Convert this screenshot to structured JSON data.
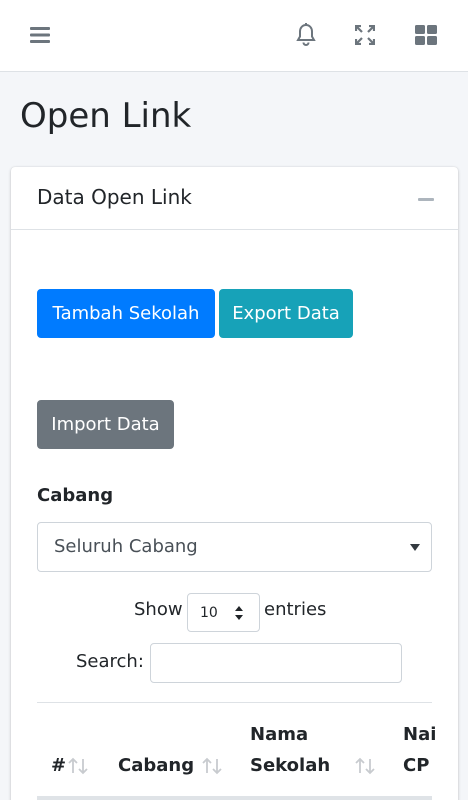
{
  "topbar": {
    "icons": [
      "hamburger-menu-icon",
      "bell-icon",
      "fullscreen-icon",
      "apps-grid-icon"
    ],
    "icon_color": "#6c757d"
  },
  "page": {
    "title": "Open Link"
  },
  "card": {
    "title": "Data Open Link",
    "buttons": {
      "add_school": "Tambah Sekolah",
      "export": "Export Data",
      "import": "Import Data"
    },
    "filter": {
      "label": "Cabang",
      "selected": "Seluruh Cabang"
    },
    "datatable": {
      "show_label": "Show",
      "page_length": "10",
      "entries_label": "entries",
      "search_label": "Search:",
      "search_value": "",
      "columns": [
        "#",
        "Cabang",
        "Nama Sekolah",
        "Nama CP"
      ],
      "visible_columns": [
        "#",
        "Cabang",
        "Nama\nSekolah",
        "Nai\nCP"
      ]
    }
  },
  "colors": {
    "primary": "#007bff",
    "info": "#17a2b8",
    "secondary": "#6c757d",
    "background": "#f4f6f9"
  }
}
